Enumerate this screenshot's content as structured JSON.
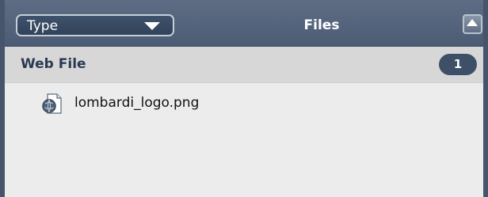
{
  "filter": {
    "label": "Type",
    "icon": "chevron-down-icon"
  },
  "panel": {
    "title": "Files",
    "collapse_icon": "triangle-up-icon"
  },
  "group": {
    "label": "Web File",
    "count": "1"
  },
  "files": [
    {
      "name": "lombardi_logo.png",
      "icon": "web-file-icon"
    }
  ],
  "colors": {
    "header_bg": "#556478",
    "dropdown_bg": "#3a4c64",
    "group_bg": "#d7d7d7",
    "list_bg": "#ececec",
    "badge_bg": "#3e5068",
    "group_text": "#2b3a52"
  }
}
